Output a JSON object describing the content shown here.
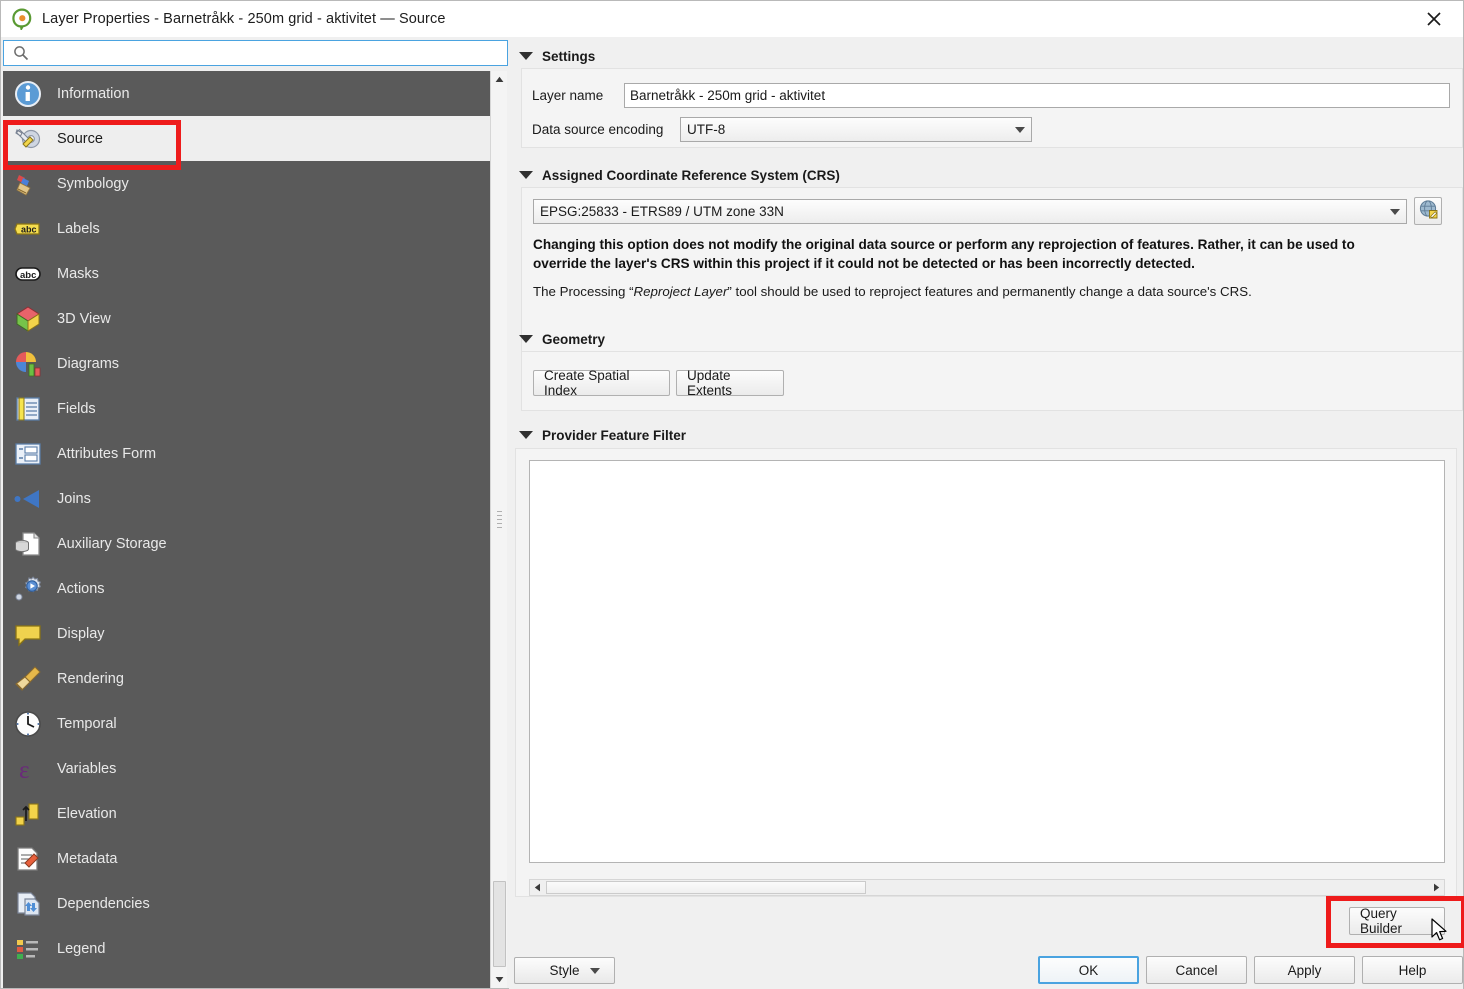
{
  "window": {
    "title": "Layer Properties - Barnetråkk - 250m grid - aktivitet — Source",
    "logo_icon": "qgis-logo-icon",
    "close_icon": "close-icon",
    "accent": "#4aa3e0",
    "annotation_color": "#ee1b1b",
    "sidebar_bg": "#5a5a5a"
  },
  "search": {
    "icon": "search-icon",
    "value": "",
    "placeholder": ""
  },
  "sidebar": {
    "items": [
      {
        "label": "Information",
        "icon": "information-icon",
        "selected": false
      },
      {
        "label": "Source",
        "icon": "source-icon",
        "selected": true
      },
      {
        "label": "Symbology",
        "icon": "symbology-icon",
        "selected": false
      },
      {
        "label": "Labels",
        "icon": "labels-icon",
        "selected": false
      },
      {
        "label": "Masks",
        "icon": "masks-icon",
        "selected": false
      },
      {
        "label": "3D View",
        "icon": "3d-view-icon",
        "selected": false
      },
      {
        "label": "Diagrams",
        "icon": "diagrams-icon",
        "selected": false
      },
      {
        "label": "Fields",
        "icon": "fields-icon",
        "selected": false
      },
      {
        "label": "Attributes Form",
        "icon": "attributes-form-icon",
        "selected": false
      },
      {
        "label": "Joins",
        "icon": "joins-icon",
        "selected": false
      },
      {
        "label": "Auxiliary Storage",
        "icon": "auxiliary-storage-icon",
        "selected": false
      },
      {
        "label": "Actions",
        "icon": "actions-icon",
        "selected": false
      },
      {
        "label": "Display",
        "icon": "display-icon",
        "selected": false
      },
      {
        "label": "Rendering",
        "icon": "rendering-icon",
        "selected": false
      },
      {
        "label": "Temporal",
        "icon": "temporal-icon",
        "selected": false
      },
      {
        "label": "Variables",
        "icon": "variables-icon",
        "selected": false
      },
      {
        "label": "Elevation",
        "icon": "elevation-icon",
        "selected": false
      },
      {
        "label": "Metadata",
        "icon": "metadata-icon",
        "selected": false
      },
      {
        "label": "Dependencies",
        "icon": "dependencies-icon",
        "selected": false
      },
      {
        "label": "Legend",
        "icon": "legend-icon",
        "selected": false
      }
    ]
  },
  "settings": {
    "section_title": "Settings",
    "layer_name_label": "Layer name",
    "layer_name_value": "Barnetråkk - 250m grid - aktivitet",
    "encoding_label": "Data source encoding",
    "encoding_value": "UTF-8"
  },
  "crs": {
    "section_title": "Assigned Coordinate Reference System (CRS)",
    "value": "EPSG:25833 - ETRS89 / UTM zone 33N",
    "select_crs_icon": "globe-edit-icon",
    "warning_line1": "Changing this option does not modify the original data source or perform any reprojection of features. Rather, it can be used to",
    "warning_line2": "override the layer's CRS within this project if it could not be detected or has been incorrectly detected.",
    "note_prefix": "The Processing “",
    "note_italic": "Reproject Layer",
    "note_suffix": "” tool should be used to reproject features and permanently change a data source's CRS."
  },
  "geometry": {
    "section_title": "Geometry",
    "create_spatial_index_label": "Create Spatial Index",
    "update_extents_label": "Update Extents"
  },
  "provider_filter": {
    "section_title": "Provider Feature Filter",
    "value": "",
    "query_builder_label": "Query Builder"
  },
  "footer": {
    "style_label": "Style",
    "ok_label": "OK",
    "cancel_label": "Cancel",
    "apply_label": "Apply",
    "help_label": "Help"
  }
}
